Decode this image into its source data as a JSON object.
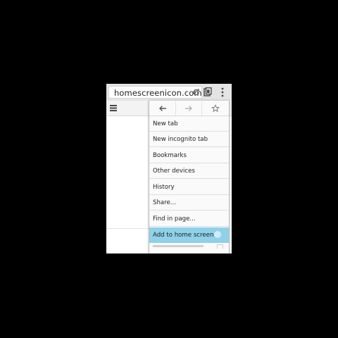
{
  "browser": {
    "url": "homescreenicon.com",
    "icons": [
      "reload-icon",
      "tabs-icon",
      "overflow-menu-icon"
    ]
  },
  "page": {
    "toolbar_icon": "hamburger-menu-icon"
  },
  "menu": {
    "nav_icons": [
      "back-arrow-icon",
      "forward-arrow-icon",
      "star-icon"
    ],
    "items": [
      {
        "label": "New tab"
      },
      {
        "label": "New incognito tab"
      },
      {
        "label": "Bookmarks"
      },
      {
        "label": "Other devices"
      },
      {
        "label": "History"
      },
      {
        "label": "Share..."
      },
      {
        "label": "Find in page..."
      },
      {
        "label": "Add to home screen",
        "highlighted": true
      }
    ],
    "highlight_color": "#8fd1ea"
  }
}
